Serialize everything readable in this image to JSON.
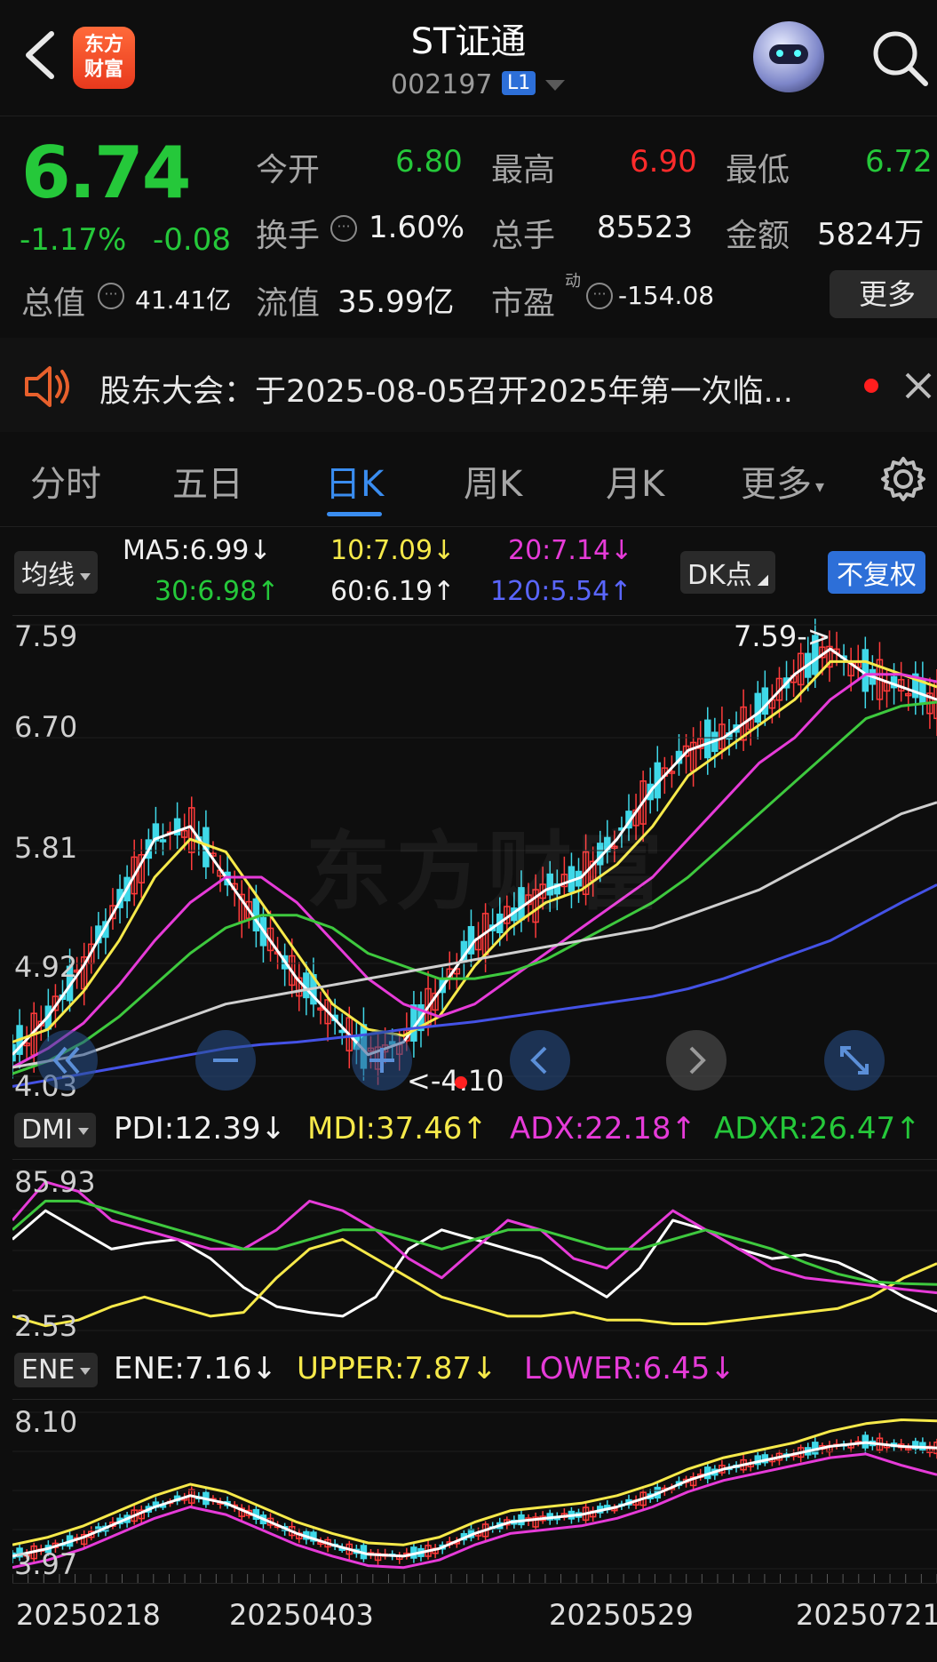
{
  "header": {
    "title": "ST证通",
    "code": "002197",
    "badge": "L1",
    "logo_line1": "东方",
    "logo_line2": "财富"
  },
  "quote": {
    "price": "6.74",
    "change_pct": "-1.17%",
    "change_abs": "-0.08",
    "open_label": "今开",
    "open_value": "6.80",
    "high_label": "最高",
    "high_value": "6.90",
    "low_label": "最低",
    "low_value": "6.72",
    "turnover_label": "换手",
    "turnover_value": "1.60%",
    "volume_label": "总手",
    "volume_value": "85523",
    "amount_label": "金额",
    "amount_value": "5824万",
    "mktcap_label": "总值",
    "mktcap_value": "41.41亿",
    "float_label": "流值",
    "float_value": "35.99亿",
    "pe_label": "市盈",
    "pe_sup": "动",
    "pe_value": "-154.08",
    "more_label": "更多"
  },
  "notice": {
    "text": "股东大会：于2025-08-05召开2025年第一次临..."
  },
  "tabs": [
    "分时",
    "五日",
    "日K",
    "周K",
    "月K",
    "更多"
  ],
  "active_tab": "日K",
  "main_chart": {
    "indicator_label": "均线",
    "ma5": "MA5:6.99↓",
    "ma10": "10:7.09↓",
    "ma20": "20:7.14↓",
    "ma30": "30:6.98↑",
    "ma60": "60:6.19↑",
    "ma120": "120:5.54↑",
    "dk_label": "DK点",
    "adjust_label": "不复权",
    "y_ticks": [
      "7.59",
      "6.70",
      "5.81",
      "4.92",
      "4.03"
    ],
    "high_marker": "7.59->",
    "low_marker": "<-4.10",
    "watermark": "东方财富",
    "colors": {
      "ma5": "#ffffff",
      "ma10": "#f6e94a",
      "ma20": "#e63bd8",
      "ma30": "#3ec93e",
      "ma60": "#cfcfcf",
      "ma120": "#4452e6"
    }
  },
  "dmi": {
    "label": "DMI",
    "pdi": "PDI:12.39↓",
    "mdi": "MDI:37.46↑",
    "adx": "ADX:22.18↑",
    "adxr": "ADXR:26.47↑",
    "y_ticks": [
      "85.93",
      "2.53"
    ]
  },
  "ene": {
    "label": "ENE",
    "ene": "ENE:7.16↓",
    "upper": "UPPER:7.87↓",
    "lower": "LOWER:6.45↓",
    "y_ticks": [
      "8.10",
      "3.97"
    ]
  },
  "x_dates": [
    "20250218",
    "20250403",
    "20250529",
    "20250721"
  ],
  "chart_data": [
    {
      "type": "line",
      "title": "",
      "series": [
        {
          "name": "MA5",
          "values": [
            4.2,
            4.5,
            4.9,
            5.4,
            5.9,
            6.0,
            5.6,
            5.2,
            4.8,
            4.5,
            4.2,
            4.3,
            4.7,
            5.1,
            5.3,
            5.5,
            5.6,
            5.9,
            6.3,
            6.6,
            6.7,
            6.9,
            7.2,
            7.4,
            7.2,
            7.1,
            7.0
          ]
        },
        {
          "name": "10",
          "values": [
            4.3,
            4.4,
            4.7,
            5.1,
            5.6,
            5.9,
            5.8,
            5.4,
            5.0,
            4.6,
            4.4,
            4.35,
            4.5,
            4.9,
            5.2,
            5.4,
            5.5,
            5.7,
            6.0,
            6.4,
            6.6,
            6.8,
            7.0,
            7.3,
            7.3,
            7.2,
            7.1
          ]
        },
        {
          "name": "20",
          "values": [
            4.1,
            4.25,
            4.45,
            4.75,
            5.1,
            5.4,
            5.6,
            5.6,
            5.4,
            5.1,
            4.8,
            4.6,
            4.5,
            4.6,
            4.8,
            5.0,
            5.2,
            5.4,
            5.6,
            5.9,
            6.2,
            6.5,
            6.7,
            7.0,
            7.2,
            7.2,
            7.14
          ]
        },
        {
          "name": "30",
          "values": [
            4.05,
            4.15,
            4.3,
            4.5,
            4.75,
            5.0,
            5.2,
            5.3,
            5.3,
            5.2,
            5.0,
            4.9,
            4.8,
            4.8,
            4.85,
            4.95,
            5.1,
            5.25,
            5.4,
            5.6,
            5.85,
            6.1,
            6.35,
            6.6,
            6.85,
            6.95,
            6.98
          ]
        },
        {
          "name": "60",
          "values": [
            4.1,
            4.15,
            4.2,
            4.3,
            4.4,
            4.5,
            4.6,
            4.65,
            4.7,
            4.75,
            4.8,
            4.85,
            4.9,
            4.95,
            5.0,
            5.05,
            5.1,
            5.15,
            5.2,
            5.3,
            5.4,
            5.5,
            5.65,
            5.8,
            5.95,
            6.1,
            6.19
          ]
        },
        {
          "name": "120",
          "values": [
            3.95,
            4.0,
            4.05,
            4.1,
            4.15,
            4.2,
            4.25,
            4.28,
            4.3,
            4.33,
            4.36,
            4.4,
            4.43,
            4.46,
            4.5,
            4.54,
            4.58,
            4.62,
            4.66,
            4.72,
            4.8,
            4.9,
            5.0,
            5.1,
            5.25,
            5.4,
            5.54
          ]
        }
      ],
      "ylim": [
        4.03,
        7.59
      ],
      "y_ticks": [
        "7.59",
        "6.70",
        "5.81",
        "4.92",
        "4.03"
      ]
    },
    {
      "type": "line",
      "title": "",
      "series": [
        {
          "name": "PDI",
          "values": [
            50,
            65,
            55,
            45,
            48,
            50,
            40,
            25,
            15,
            12,
            10,
            20,
            45,
            55,
            50,
            45,
            40,
            30,
            20,
            35,
            60,
            55,
            45,
            40,
            42,
            38,
            30,
            20,
            12.39
          ]
        },
        {
          "name": "MDI",
          "values": [
            10,
            5,
            8,
            15,
            20,
            15,
            10,
            12,
            30,
            45,
            50,
            40,
            30,
            20,
            15,
            10,
            10,
            12,
            8,
            8,
            6,
            6,
            8,
            10,
            12,
            14,
            20,
            30,
            37.46
          ]
        },
        {
          "name": "ADX",
          "values": [
            60,
            80,
            75,
            60,
            55,
            50,
            45,
            45,
            55,
            70,
            65,
            55,
            40,
            30,
            45,
            60,
            55,
            40,
            35,
            50,
            65,
            55,
            45,
            35,
            30,
            28,
            26,
            24,
            22.18
          ]
        },
        {
          "name": "ADXR",
          "values": [
            55,
            70,
            70,
            65,
            60,
            55,
            50,
            45,
            45,
            50,
            55,
            55,
            50,
            45,
            50,
            55,
            55,
            50,
            45,
            45,
            50,
            55,
            50,
            45,
            38,
            32,
            28,
            27,
            26.47
          ]
        }
      ],
      "ylim": [
        2.53,
        85.93
      ],
      "y_ticks": [
        "85.93",
        "2.53"
      ]
    },
    {
      "type": "line",
      "title": "",
      "series": [
        {
          "name": "ENE",
          "values": [
            4.3,
            4.5,
            4.8,
            5.2,
            5.6,
            5.9,
            5.7,
            5.3,
            4.9,
            4.6,
            4.35,
            4.3,
            4.5,
            4.9,
            5.2,
            5.3,
            5.4,
            5.6,
            5.9,
            6.3,
            6.6,
            6.8,
            7.0,
            7.2,
            7.3,
            7.2,
            7.16
          ]
        },
        {
          "name": "UPPER",
          "values": [
            4.6,
            4.8,
            5.1,
            5.5,
            5.9,
            6.2,
            6.0,
            5.6,
            5.2,
            4.9,
            4.65,
            4.6,
            4.8,
            5.2,
            5.5,
            5.6,
            5.7,
            5.9,
            6.2,
            6.6,
            6.9,
            7.1,
            7.3,
            7.6,
            7.8,
            7.9,
            7.87
          ]
        },
        {
          "name": "LOWER",
          "values": [
            4.0,
            4.2,
            4.5,
            4.9,
            5.3,
            5.6,
            5.4,
            5.0,
            4.6,
            4.3,
            4.05,
            4.0,
            4.2,
            4.6,
            4.9,
            5.0,
            5.1,
            5.3,
            5.6,
            6.0,
            6.3,
            6.5,
            6.7,
            6.9,
            7.0,
            6.7,
            6.45
          ]
        }
      ],
      "ylim": [
        3.97,
        8.1
      ],
      "y_ticks": [
        "8.10",
        "3.97"
      ]
    }
  ]
}
